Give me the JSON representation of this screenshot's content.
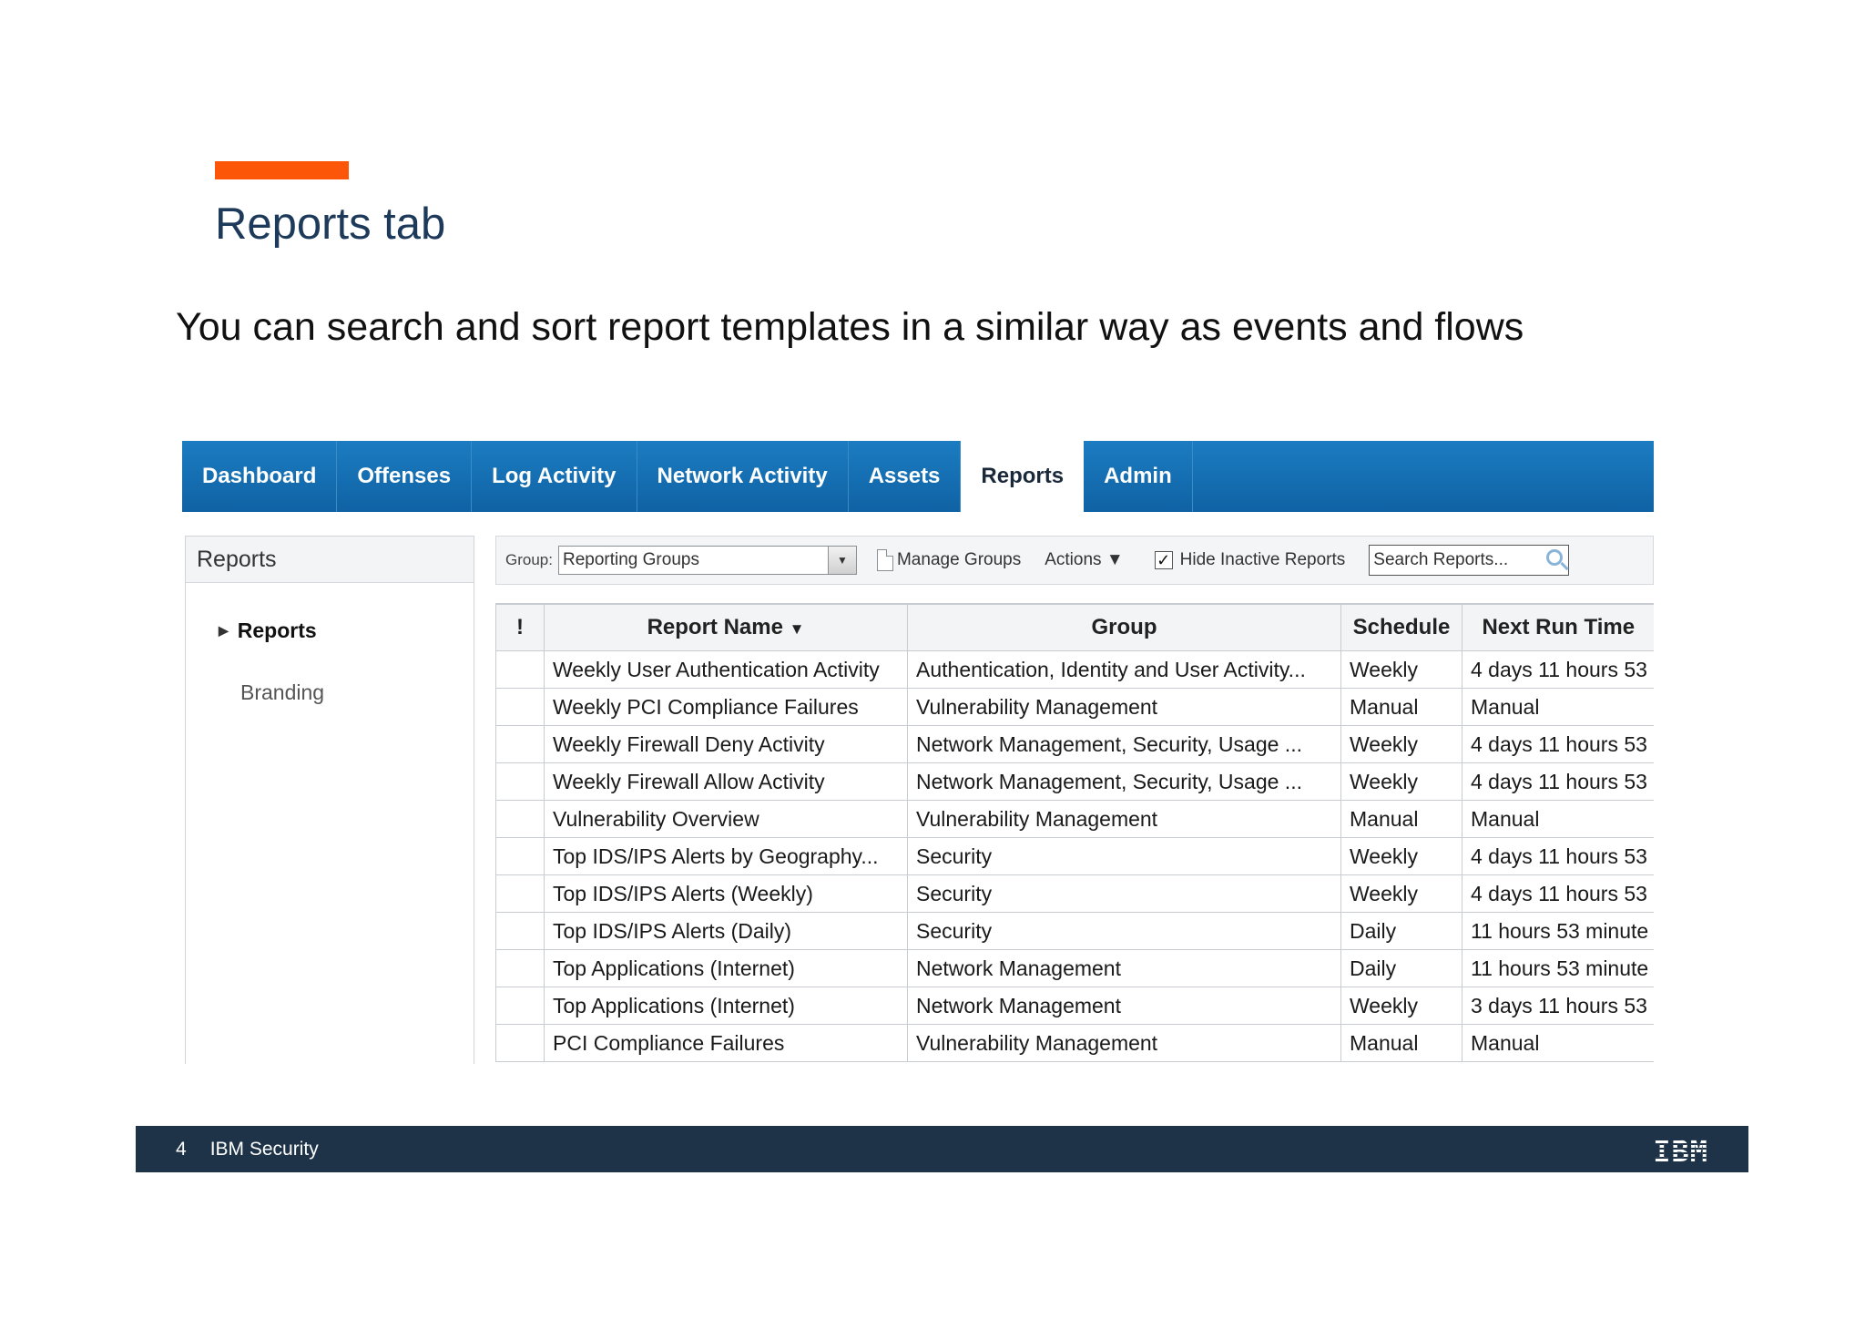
{
  "slide": {
    "title": "Reports tab",
    "subtitle": "You can search and sort report templates in a similar way as events and flows",
    "accent_color": "#fc5608"
  },
  "tabs": [
    {
      "label": "Dashboard",
      "active": false
    },
    {
      "label": "Offenses",
      "active": false
    },
    {
      "label": "Log Activity",
      "active": false
    },
    {
      "label": "Network Activity",
      "active": false
    },
    {
      "label": "Assets",
      "active": false
    },
    {
      "label": "Reports",
      "active": true
    },
    {
      "label": "Admin",
      "active": false
    }
  ],
  "sidebar": {
    "header": "Reports",
    "items": [
      {
        "label": "Reports",
        "expanded_icon": "triangle-right-icon"
      },
      {
        "label": "Branding"
      }
    ]
  },
  "toolbar": {
    "group_label": "Group:",
    "group_value": "Reporting Groups",
    "manage_groups": "Manage Groups",
    "actions": "Actions ▼",
    "hide_inactive": "Hide Inactive Reports",
    "hide_inactive_checked": true,
    "search_placeholder": "Search Reports..."
  },
  "table": {
    "columns": [
      "!",
      "Report Name",
      "Group",
      "Schedule",
      "Next Run Time"
    ],
    "sort_indicator": "▼",
    "rows": [
      [
        "",
        "Weekly User Authentication Activity",
        "Authentication, Identity and User Activity...",
        "Weekly",
        "4 days 11 hours 53"
      ],
      [
        "",
        "Weekly PCI Compliance Failures",
        "Vulnerability Management",
        "Manual",
        "Manual"
      ],
      [
        "",
        "Weekly Firewall Deny Activity",
        "Network Management, Security, Usage ...",
        "Weekly",
        "4 days 11 hours 53"
      ],
      [
        "",
        "Weekly Firewall Allow Activity",
        "Network Management, Security, Usage ...",
        "Weekly",
        "4 days 11 hours 53"
      ],
      [
        "",
        "Vulnerability Overview",
        "Vulnerability Management",
        "Manual",
        "Manual"
      ],
      [
        "",
        "Top IDS/IPS Alerts by Geography...",
        "Security",
        "Weekly",
        "4 days 11 hours 53"
      ],
      [
        "",
        "Top IDS/IPS Alerts (Weekly)",
        "Security",
        "Weekly",
        "4 days 11 hours 53"
      ],
      [
        "",
        "Top IDS/IPS Alerts (Daily)",
        "Security",
        "Daily",
        "11 hours 53 minute"
      ],
      [
        "",
        "Top Applications (Internet)",
        "Network Management",
        "Daily",
        "11 hours 53 minute"
      ],
      [
        "",
        "Top Applications (Internet)",
        "Network Management",
        "Weekly",
        "3 days 11 hours 53"
      ],
      [
        "",
        "PCI Compliance Failures",
        "Vulnerability Management",
        "Manual",
        "Manual"
      ]
    ]
  },
  "footer": {
    "page_number": "4",
    "org": "IBM Security",
    "logo": "IBM"
  }
}
